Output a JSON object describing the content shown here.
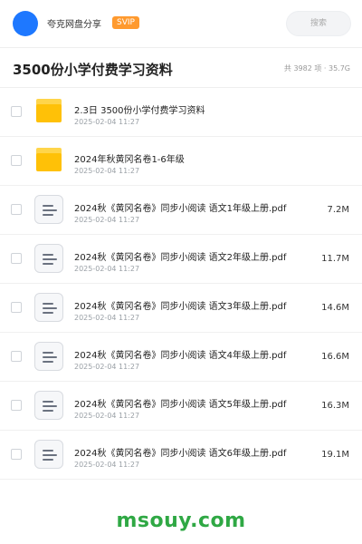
{
  "header": {
    "app_name": "夸克网盘分享",
    "badge": "SVIP",
    "search_placeholder": "搜索",
    "avatar_color": "#1e78ff"
  },
  "share": {
    "title": "3500份小学付费学习资料",
    "summary": "共 3982 项 · 35.7G"
  },
  "items": [
    {
      "type": "folder",
      "icon": "folder-icon",
      "name": "2.3日 3500份小学付费学习资料",
      "date": "2025-02-04 11:27",
      "size": ""
    },
    {
      "type": "folder",
      "icon": "folder-icon",
      "name": "2024年秋黄冈名卷1-6年级",
      "date": "2025-02-04 11:27",
      "size": ""
    },
    {
      "type": "file",
      "icon": "document-icon",
      "name": "2024秋《黄冈名卷》同步小阅读 语文1年级上册.pdf",
      "date": "2025-02-04 11:27",
      "size": "7.2M"
    },
    {
      "type": "file",
      "icon": "document-icon",
      "name": "2024秋《黄冈名卷》同步小阅读 语文2年级上册.pdf",
      "date": "2025-02-04 11:27",
      "size": "11.7M"
    },
    {
      "type": "file",
      "icon": "document-icon",
      "name": "2024秋《黄冈名卷》同步小阅读 语文3年级上册.pdf",
      "date": "2025-02-04 11:27",
      "size": "14.6M"
    },
    {
      "type": "file",
      "icon": "document-icon",
      "name": "2024秋《黄冈名卷》同步小阅读 语文4年级上册.pdf",
      "date": "2025-02-04 11:27",
      "size": "16.6M"
    },
    {
      "type": "file",
      "icon": "document-icon",
      "name": "2024秋《黄冈名卷》同步小阅读 语文5年级上册.pdf",
      "date": "2025-02-04 11:27",
      "size": "16.3M"
    },
    {
      "type": "file",
      "icon": "document-icon",
      "name": "2024秋《黄冈名卷》同步小阅读 语文6年级上册.pdf",
      "date": "2025-02-04 11:27",
      "size": "19.1M"
    }
  ],
  "watermark": "msouy.com",
  "colors": {
    "folder": "#ffc107",
    "badge": "#ff9a2e",
    "watermark": "#2fa844"
  }
}
